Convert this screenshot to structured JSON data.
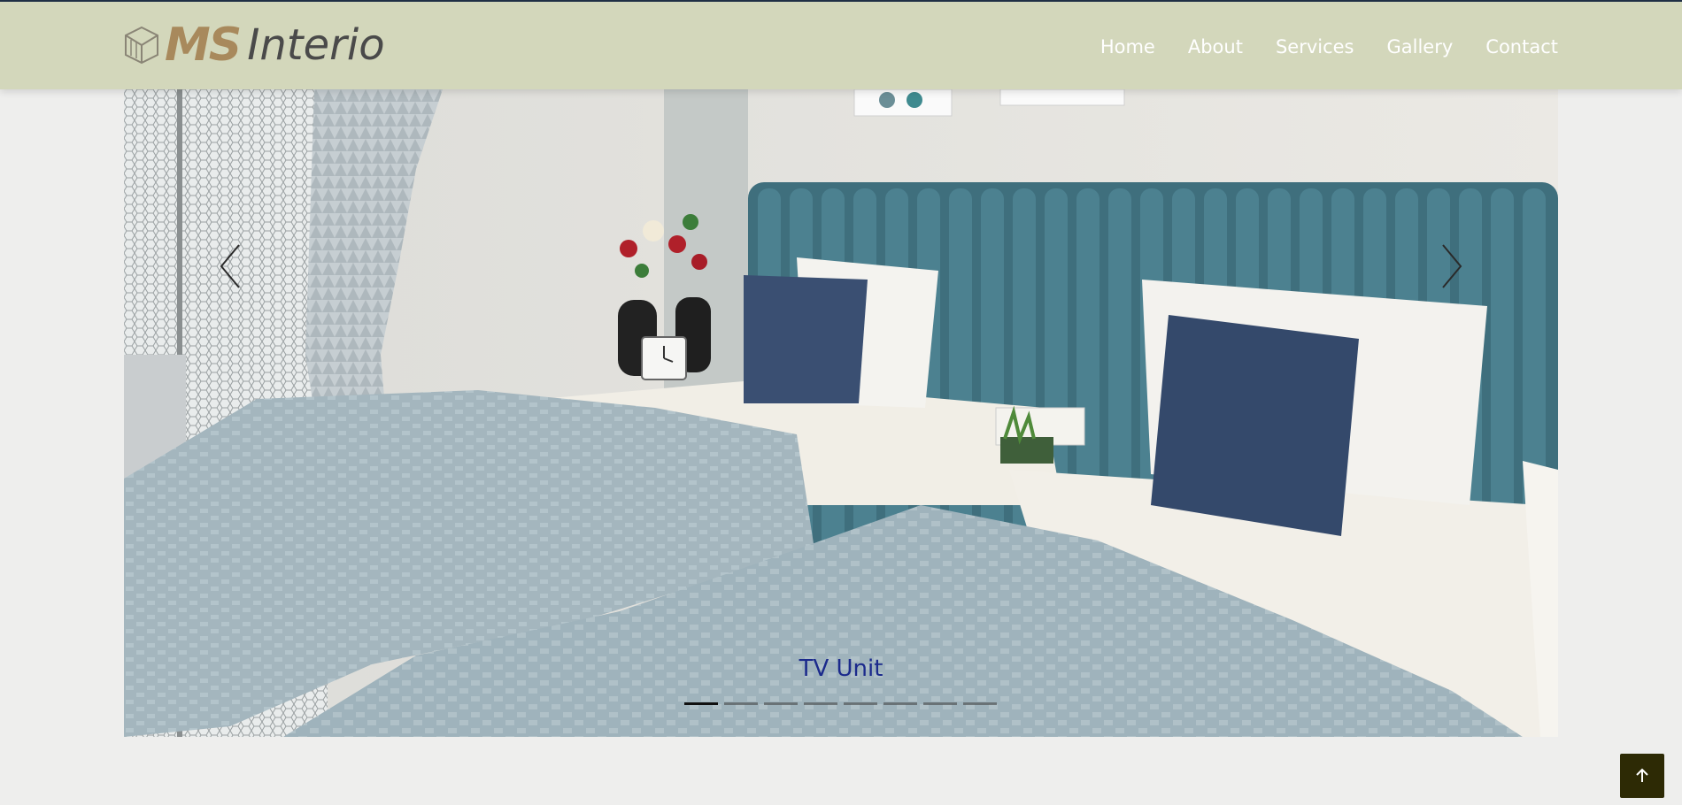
{
  "brand": {
    "logo_ms": "MS",
    "logo_interio": "Interio",
    "icon": "cube-logo-icon"
  },
  "nav": {
    "items": [
      {
        "label": "Home"
      },
      {
        "label": "About"
      },
      {
        "label": "Services"
      },
      {
        "label": "Gallery"
      },
      {
        "label": "Contact"
      }
    ]
  },
  "carousel": {
    "caption": "TV Unit",
    "slide_count": 8,
    "active_index": 0,
    "prev_icon": "chevron-left-icon",
    "next_icon": "chevron-right-icon"
  },
  "back_to_top": {
    "icon": "arrow-up-icon"
  },
  "colors": {
    "header_bg": "#d3d7bb",
    "logo_gold": "#a8895c",
    "caption": "#1b2a8c",
    "back_to_top_bg": "#2d2a05",
    "page_bg": "#eeeeed"
  }
}
